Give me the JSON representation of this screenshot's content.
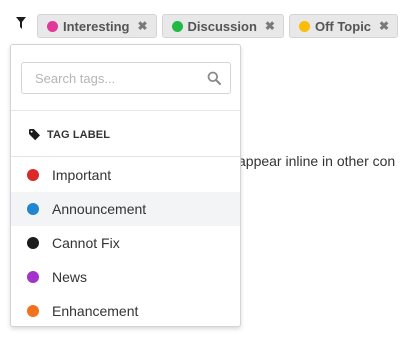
{
  "filter": {
    "icon": "filter-icon",
    "chips": [
      {
        "label": "Interesting",
        "color": "#e03997",
        "remove_icon": "close-icon",
        "remove_glyph": "✖"
      },
      {
        "label": "Discussion",
        "color": "#21ba45",
        "remove_icon": "close-icon",
        "remove_glyph": "✖"
      },
      {
        "label": "Off Topic",
        "color": "#fbbd08",
        "remove_icon": "close-icon",
        "remove_glyph": "✖"
      }
    ]
  },
  "background": {
    "text": "appear inline in other con",
    "fragment": "."
  },
  "dropdown": {
    "search": {
      "placeholder": "Search tags...",
      "value": "",
      "icon": "search-icon"
    },
    "header": {
      "icon": "tag-icon",
      "label": "TAG LABEL"
    },
    "items": [
      {
        "label": "Important",
        "color": "#db2828"
      },
      {
        "label": "Announcement",
        "color": "#2185d0",
        "hovered": true
      },
      {
        "label": "Cannot Fix",
        "color": "#1b1c1d"
      },
      {
        "label": "News",
        "color": "#a333c8"
      },
      {
        "label": "Enhancement",
        "color": "#f2711c"
      }
    ]
  }
}
